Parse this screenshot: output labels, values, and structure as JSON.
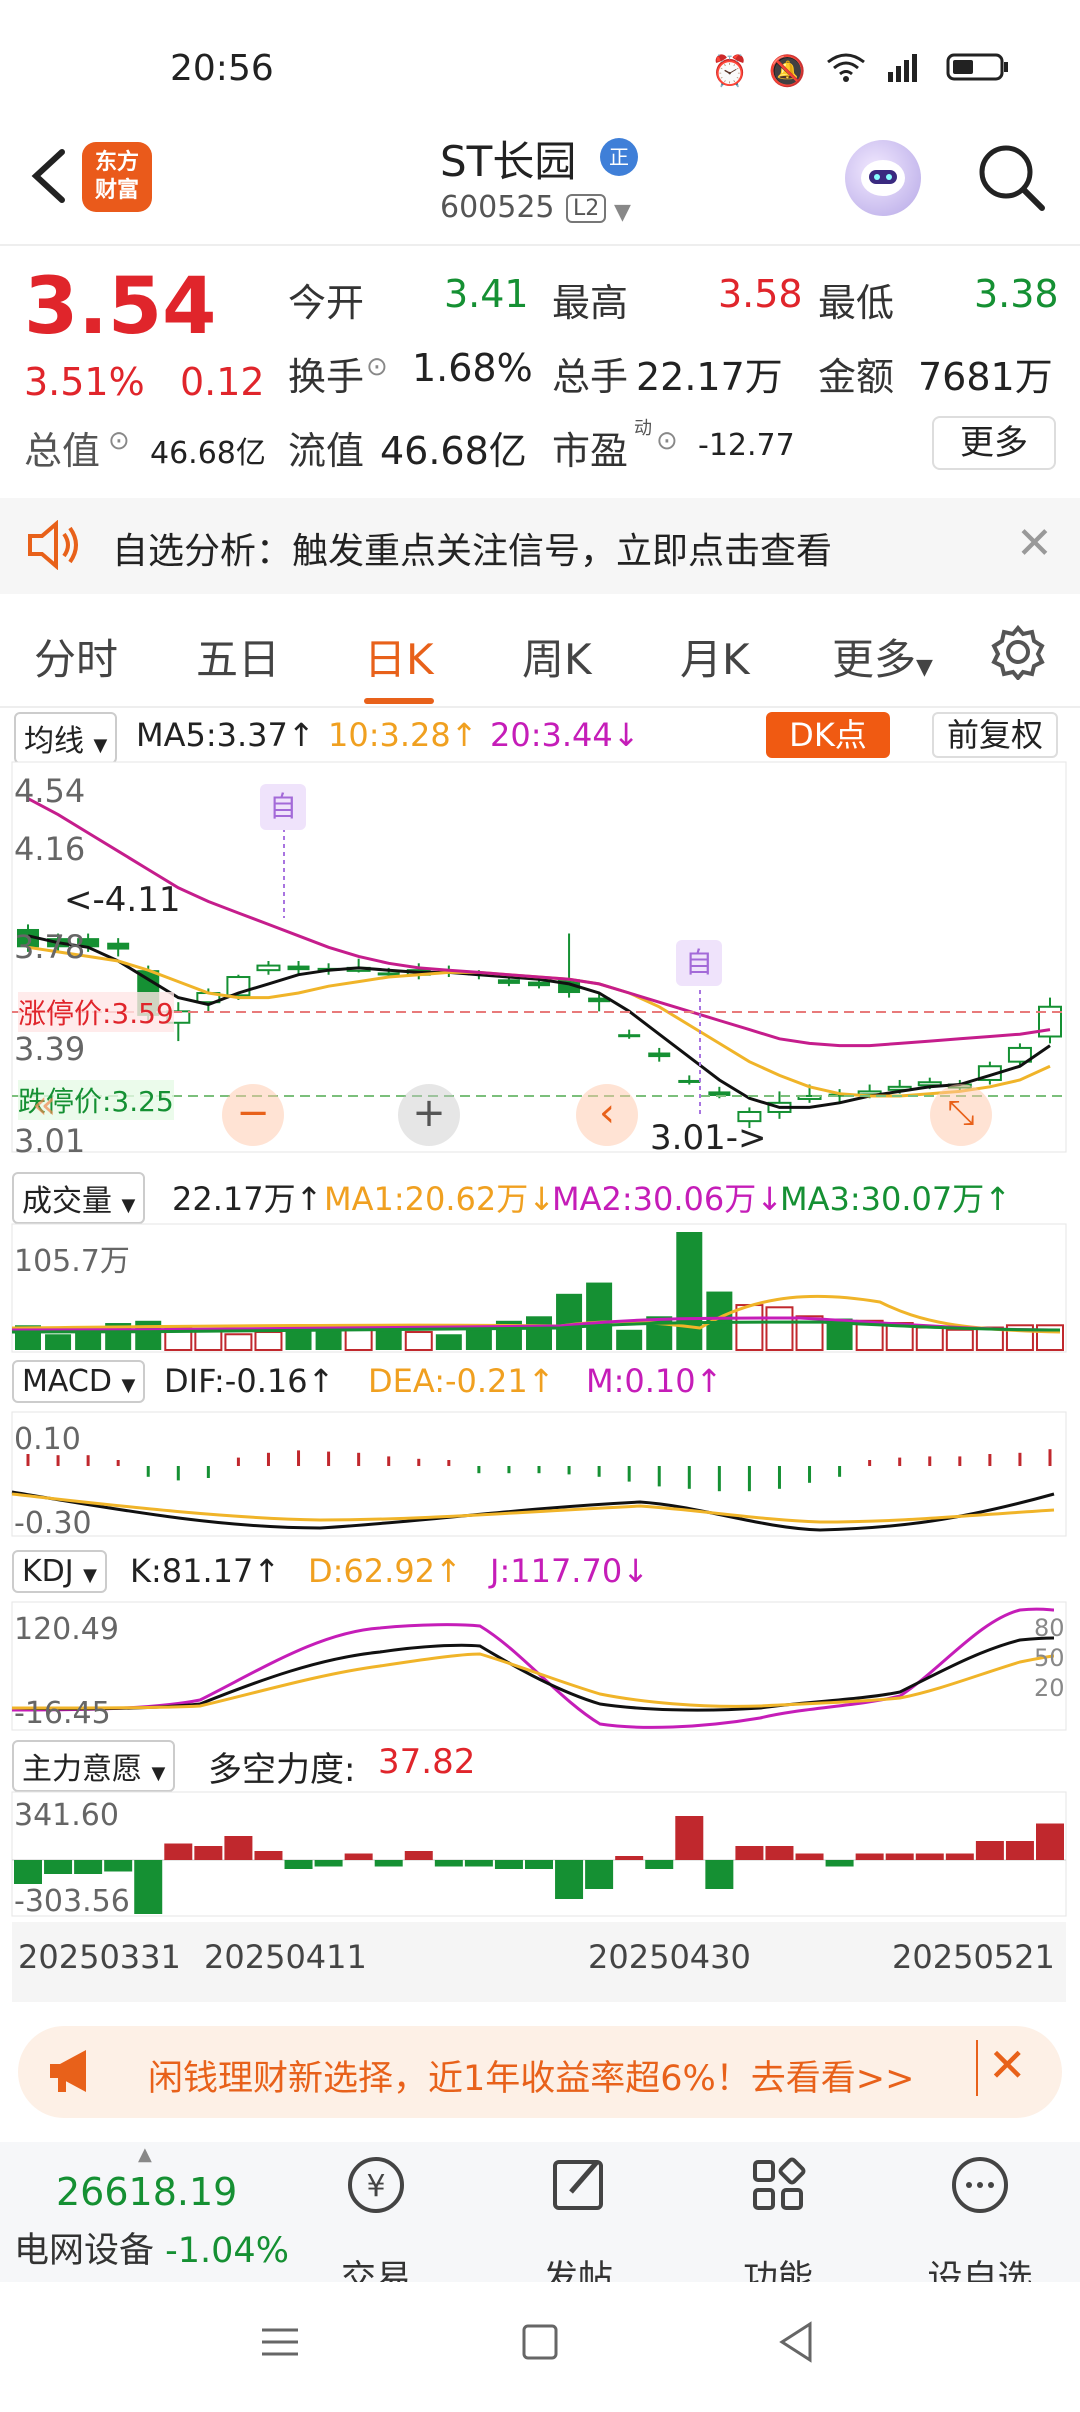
{
  "status": {
    "time": "20:56"
  },
  "header": {
    "title": "ST长园",
    "badge": "正",
    "code": "600525",
    "level": "L2",
    "logo": "东方\n财富"
  },
  "quote": {
    "price": "3.54",
    "pct": "3.51%",
    "chg": "0.12",
    "open_l": "今开",
    "open": "3.41",
    "high_l": "最高",
    "high": "3.58",
    "low_l": "最低",
    "low": "3.38",
    "turn_l": "换手",
    "turn": "1.68%",
    "vol_l": "总手",
    "vol": "22.17万",
    "amt_l": "金额",
    "amt": "7681万",
    "mcap_l": "总值",
    "mcap": "46.68亿",
    "float_l": "流值",
    "float": "46.68亿",
    "pe_l": "市盈",
    "pe_sup": "动",
    "pe": "-12.77",
    "more": "更多"
  },
  "notice": {
    "text": "自选分析：触发重点关注信号，立即点击查看"
  },
  "tabs": [
    "分时",
    "五日",
    "日K",
    "周K",
    "月K",
    "更多"
  ],
  "indicators": {
    "ma_sel": "均线",
    "ma5": "MA5:3.37",
    "ma10": "10:3.28",
    "ma20": "20:3.44",
    "dk": "DK点",
    "fq": "前复权",
    "ylabels": [
      "4.54",
      "4.16",
      "3.78",
      "3.39",
      "3.01"
    ],
    "high_mark": "<-4.11",
    "low_mark": "3.01->",
    "up_limit": "涨停价:3.59",
    "down_limit": "跌停价:3.25",
    "zi": "自",
    "vol_sel": "成交量",
    "vol_val": "22.17万",
    "vma1": "MA1:20.62万",
    "vma2": "MA2:30.06万",
    "vma3": "MA3:30.07万",
    "vol_max": "105.7万",
    "macd_sel": "MACD",
    "dif": "DIF:-0.16",
    "dea": "DEA:-0.21",
    "m": "M:0.10",
    "macd_top": "0.10",
    "macd_bot": "-0.30",
    "kdj_sel": "KDJ",
    "k": "K:81.17",
    "d": "D:62.92",
    "j": "J:117.70",
    "kdj_top": "120.49",
    "kdj_bot": "-16.45",
    "kdj_levels": [
      "80",
      "50",
      "20"
    ],
    "zl_sel": "主力意愿",
    "zl_label": "多空力度:",
    "zl_val": "37.82",
    "zl_top": "341.60",
    "zl_bot": "-303.56",
    "dates": [
      "20250331",
      "20250411",
      "20250430",
      "20250521"
    ]
  },
  "chart_data": {
    "type": "candlestick",
    "ylim": [
      3.01,
      4.54
    ],
    "candles": [
      {
        "o": 3.88,
        "c": 3.8,
        "h": 3.9,
        "l": 3.78
      },
      {
        "o": 3.84,
        "c": 3.8,
        "h": 3.86,
        "l": 3.78
      },
      {
        "o": 3.84,
        "c": 3.8,
        "h": 3.86,
        "l": 3.78
      },
      {
        "o": 3.82,
        "c": 3.79,
        "h": 3.84,
        "l": 3.76
      },
      {
        "o": 3.7,
        "c": 3.5,
        "h": 3.72,
        "l": 3.48
      },
      {
        "o": 3.47,
        "c": 3.52,
        "h": 3.56,
        "l": 3.39
      },
      {
        "o": 3.56,
        "c": 3.6,
        "h": 3.62,
        "l": 3.52
      },
      {
        "o": 3.59,
        "c": 3.67,
        "h": 3.68,
        "l": 3.57
      },
      {
        "o": 3.7,
        "c": 3.72,
        "h": 3.74,
        "l": 3.68
      },
      {
        "o": 3.72,
        "c": 3.7,
        "h": 3.74,
        "l": 3.68
      },
      {
        "o": 3.71,
        "c": 3.7,
        "h": 3.73,
        "l": 3.68
      },
      {
        "o": 3.7,
        "c": 3.71,
        "h": 3.75,
        "l": 3.69
      },
      {
        "o": 3.69,
        "c": 3.68,
        "h": 3.71,
        "l": 3.67
      },
      {
        "o": 3.68,
        "c": 3.7,
        "h": 3.73,
        "l": 3.66
      },
      {
        "o": 3.7,
        "c": 3.69,
        "h": 3.72,
        "l": 3.67
      },
      {
        "o": 3.69,
        "c": 3.68,
        "h": 3.7,
        "l": 3.66
      },
      {
        "o": 3.66,
        "c": 3.64,
        "h": 3.68,
        "l": 3.63
      },
      {
        "o": 3.65,
        "c": 3.63,
        "h": 3.67,
        "l": 3.62
      },
      {
        "o": 3.66,
        "c": 3.6,
        "h": 3.86,
        "l": 3.58
      },
      {
        "o": 3.58,
        "c": 3.56,
        "h": 3.6,
        "l": 3.52
      },
      {
        "o": 3.42,
        "c": 3.42,
        "h": 3.44,
        "l": 3.4
      },
      {
        "o": 3.34,
        "c": 3.32,
        "h": 3.36,
        "l": 3.3
      },
      {
        "o": 3.22,
        "c": 3.22,
        "h": 3.24,
        "l": 3.2
      },
      {
        "o": 3.17,
        "c": 3.15,
        "h": 3.19,
        "l": 3.14
      },
      {
        "o": 3.04,
        "c": 3.08,
        "h": 3.1,
        "l": 3.01
      },
      {
        "o": 3.08,
        "c": 3.12,
        "h": 3.17,
        "l": 3.05
      },
      {
        "o": 3.14,
        "c": 3.15,
        "h": 3.2,
        "l": 3.12
      },
      {
        "o": 3.16,
        "c": 3.15,
        "h": 3.18,
        "l": 3.12
      },
      {
        "o": 3.16,
        "c": 3.17,
        "h": 3.2,
        "l": 3.14
      },
      {
        "o": 3.18,
        "c": 3.19,
        "h": 3.22,
        "l": 3.16
      },
      {
        "o": 3.2,
        "c": 3.21,
        "h": 3.23,
        "l": 3.18
      },
      {
        "o": 3.19,
        "c": 3.2,
        "h": 3.22,
        "l": 3.17
      },
      {
        "o": 3.22,
        "c": 3.28,
        "h": 3.3,
        "l": 3.2
      },
      {
        "o": 3.3,
        "c": 3.36,
        "h": 3.38,
        "l": 3.28
      },
      {
        "o": 3.41,
        "c": 3.54,
        "h": 3.58,
        "l": 3.38
      }
    ],
    "ma5": [
      3.85,
      3.82,
      3.8,
      3.74,
      3.66,
      3.58,
      3.55,
      3.6,
      3.64,
      3.68,
      3.7,
      3.71,
      3.7,
      3.69,
      3.69,
      3.68,
      3.67,
      3.66,
      3.64,
      3.6,
      3.52,
      3.42,
      3.32,
      3.22,
      3.14,
      3.1,
      3.1,
      3.12,
      3.15,
      3.17,
      3.19,
      3.2,
      3.24,
      3.28,
      3.37
    ],
    "ma10": [
      3.8,
      3.78,
      3.76,
      3.74,
      3.7,
      3.65,
      3.6,
      3.58,
      3.58,
      3.6,
      3.63,
      3.65,
      3.67,
      3.68,
      3.69,
      3.69,
      3.68,
      3.67,
      3.66,
      3.64,
      3.6,
      3.54,
      3.46,
      3.38,
      3.3,
      3.24,
      3.19,
      3.16,
      3.15,
      3.15,
      3.16,
      3.17,
      3.19,
      3.22,
      3.28
    ],
    "ma20": [
      4.45,
      4.38,
      4.3,
      4.22,
      4.14,
      4.06,
      4.0,
      3.95,
      3.9,
      3.85,
      3.8,
      3.76,
      3.73,
      3.71,
      3.7,
      3.69,
      3.68,
      3.67,
      3.66,
      3.64,
      3.6,
      3.56,
      3.52,
      3.48,
      3.44,
      3.4,
      3.38,
      3.37,
      3.37,
      3.38,
      3.39,
      3.4,
      3.41,
      3.42,
      3.44
    ],
    "volume": [
      22,
      14,
      16,
      24,
      26,
      20,
      18,
      14,
      16,
      20,
      18,
      22,
      18,
      16,
      14,
      20,
      26,
      30,
      50,
      60,
      18,
      30,
      105,
      52,
      40,
      38,
      30,
      28,
      26,
      24,
      20,
      18,
      20,
      22,
      22
    ]
  }
}
